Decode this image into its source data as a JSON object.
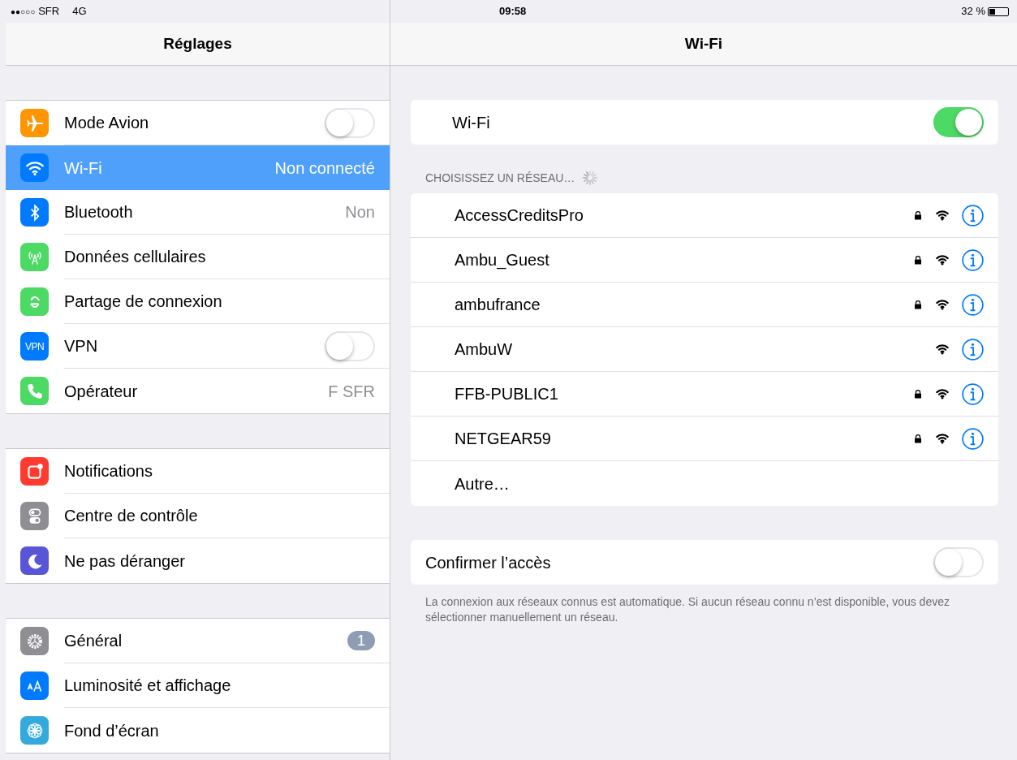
{
  "status_bar": {
    "signal": "●●○○○",
    "carrier": "SFR",
    "network": "4G",
    "time": "09:58",
    "battery_percent": "32 %"
  },
  "sidebar": {
    "title": "Réglages",
    "groups": [
      {
        "items": [
          {
            "label": "Mode Avion",
            "kind": "toggle",
            "on": false,
            "selected": false
          },
          {
            "label": "Wi-Fi",
            "kind": "value",
            "value": "Non connecté",
            "selected": true
          },
          {
            "label": "Bluetooth",
            "kind": "value",
            "value": "Non",
            "selected": false
          },
          {
            "label": "Données cellulaires",
            "kind": "plain",
            "selected": false
          },
          {
            "label": "Partage de connexion",
            "kind": "plain",
            "selected": false
          },
          {
            "label": "VPN",
            "kind": "toggle",
            "on": false,
            "selected": false,
            "icon_text": "VPN"
          },
          {
            "label": "Opérateur",
            "kind": "value",
            "value": "F SFR",
            "selected": false
          }
        ]
      },
      {
        "items": [
          {
            "label": "Notifications",
            "kind": "plain",
            "selected": false
          },
          {
            "label": "Centre de contrôle",
            "kind": "plain",
            "selected": false
          },
          {
            "label": "Ne pas déranger",
            "kind": "plain",
            "selected": false
          }
        ]
      },
      {
        "items": [
          {
            "label": "Général",
            "kind": "badge",
            "value": "1",
            "selected": false
          },
          {
            "label": "Luminosité et affichage",
            "kind": "plain",
            "selected": false
          },
          {
            "label": "Fond d’écran",
            "kind": "plain",
            "selected": false
          }
        ]
      }
    ]
  },
  "detail": {
    "title": "Wi-Fi",
    "wifi_toggle": {
      "label": "Wi-Fi",
      "on": true
    },
    "networks_header": "CHOISISSEZ UN RÉSEAU…",
    "networks": [
      {
        "name": "AccessCreditsPro",
        "locked": true
      },
      {
        "name": "Ambu_Guest",
        "locked": true
      },
      {
        "name": "ambufrance",
        "locked": true
      },
      {
        "name": "AmbuW",
        "locked": false
      },
      {
        "name": "FFB-PUBLIC1",
        "locked": true
      },
      {
        "name": "NETGEAR59",
        "locked": true
      }
    ],
    "other": "Autre…",
    "ask_toggle": {
      "label": "Confirmer l’accès",
      "on": false
    },
    "footer": "La connexion aux réseaux connus est automatique. Si aucun réseau connu n’est disponible, vous devez sélectionner manuellement un réseau."
  }
}
